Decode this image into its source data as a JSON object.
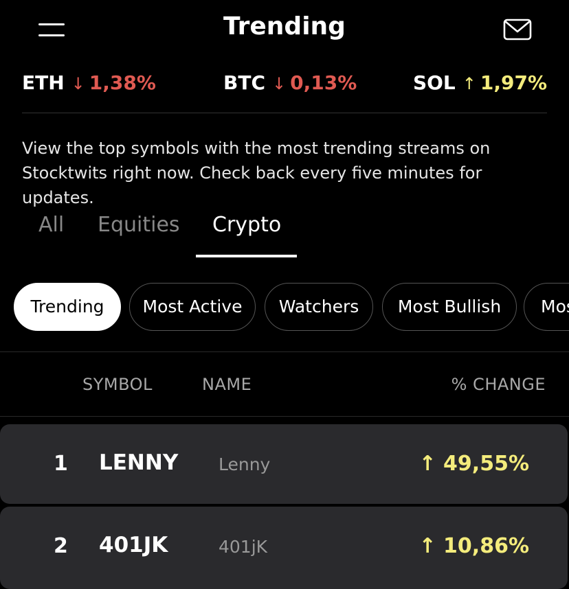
{
  "header": {
    "title": "Trending"
  },
  "ticker": [
    {
      "symbol": "ETH",
      "arrow": "↓",
      "change": "1,38%",
      "direction": "down"
    },
    {
      "symbol": "BTC",
      "arrow": "↓",
      "change": "0,13%",
      "direction": "down"
    },
    {
      "symbol": "SOL",
      "arrow": "↑",
      "change": "1,97%",
      "direction": "up"
    }
  ],
  "description": "View the top symbols with the most trending streams on Stocktwits right now. Check back every five minutes for updates.",
  "tabs": [
    {
      "label": "All"
    },
    {
      "label": "Equities"
    },
    {
      "label": "Crypto",
      "active": true
    }
  ],
  "chips": [
    {
      "label": "Trending",
      "active": true
    },
    {
      "label": "Most Active"
    },
    {
      "label": "Watchers"
    },
    {
      "label": "Most Bullish"
    },
    {
      "label": "Mos"
    }
  ],
  "columns": {
    "symbol": "SYMBOL",
    "name": "NAME",
    "change": "% CHANGE"
  },
  "rows": [
    {
      "rank": "1",
      "symbol": "LENNY",
      "name": "Lenny",
      "arrow": "↑",
      "change": "49,55%"
    },
    {
      "rank": "2",
      "symbol": "401JK",
      "name": "401jK",
      "arrow": "↑",
      "change": "10,86%"
    }
  ],
  "colors": {
    "down": "#e05a52",
    "up": "#f4ec7c",
    "row_bg": "#2a2a2d"
  },
  "icons": {
    "menu": "hamburger-menu-icon",
    "mail": "mail-envelope-icon",
    "up": "arrow-up-icon",
    "down": "arrow-down-icon"
  }
}
